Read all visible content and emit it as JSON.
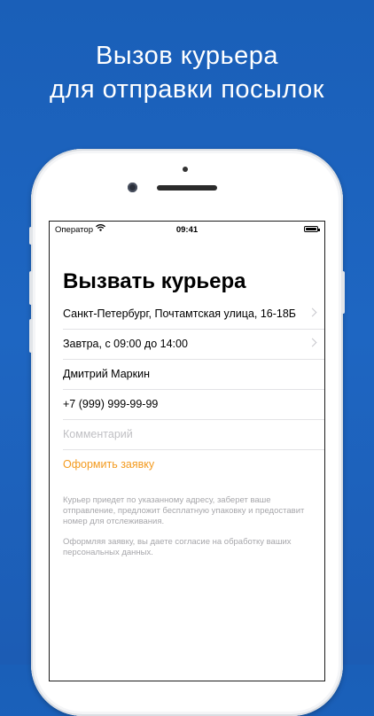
{
  "headline": {
    "line1": "Вызов курьера",
    "line2": "для отправки посылок"
  },
  "status_bar": {
    "carrier": "Оператор",
    "time": "09:41",
    "battery_level": 1.0
  },
  "screen": {
    "title": "Вызвать курьера",
    "rows": [
      {
        "text": "Санкт-Петербург, Почтамтская улица, 16-18Б",
        "chevron": true
      },
      {
        "text": "Завтра, с 09:00 до 14:00",
        "chevron": true
      },
      {
        "text": "Дмитрий Маркин"
      },
      {
        "text": "+7 (999) 999-99-99"
      }
    ],
    "comment_placeholder": "Комментарий",
    "submit_label": "Оформить заявку",
    "note1": "Курьер приедет по указанному адресу, заберет ваше отправление, предложит бесплатную упаковку и предоставит номер для отслеживания.",
    "note2": "Оформляя заявку, вы даете согласие на обработку ваших персональных данных."
  },
  "colors": {
    "background": "#1e66c2",
    "accent": "#f39a1e"
  }
}
